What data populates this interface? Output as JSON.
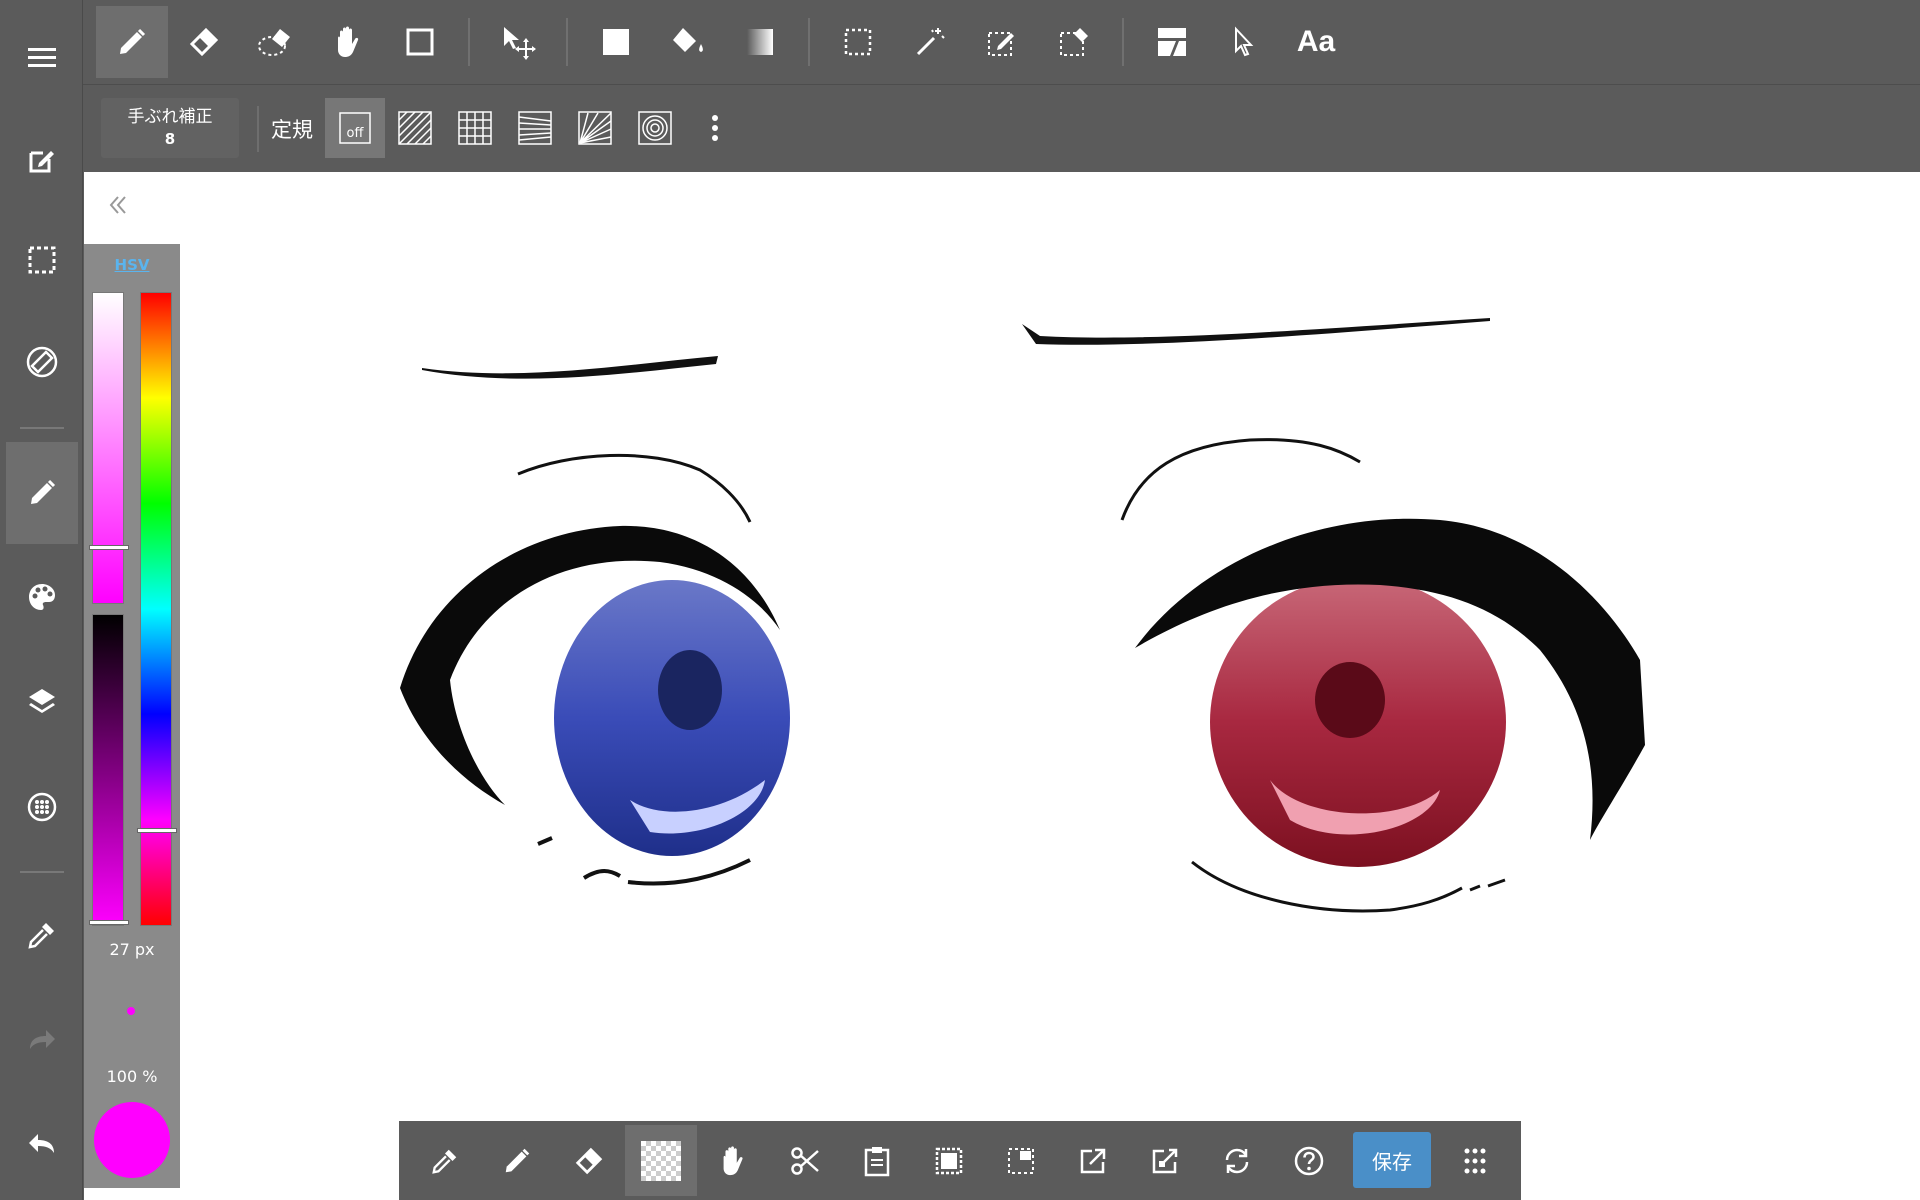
{
  "left_sidebar": {
    "items": [
      {
        "icon": "menu-icon"
      },
      {
        "icon": "edit-canvas-icon"
      },
      {
        "icon": "selection-icon"
      },
      {
        "icon": "rotate-canvas-icon"
      },
      {
        "icon": "pen-icon",
        "active": true
      },
      {
        "icon": "palette-icon"
      },
      {
        "icon": "layers-icon"
      },
      {
        "icon": "material-icon"
      },
      {
        "icon": "eyedropper-icon"
      },
      {
        "icon": "redo-icon"
      },
      {
        "icon": "undo-icon"
      }
    ]
  },
  "top_toolbar": {
    "tools": [
      "pen-icon",
      "eraser-icon",
      "lasso-eraser-icon",
      "hand-icon",
      "shape-icon",
      "move-icon",
      "fill-icon",
      "bucket-icon",
      "gradient-icon",
      "select-rect-icon",
      "magic-wand-icon",
      "select-pen-icon",
      "select-eraser-icon",
      "frame-divider-icon",
      "operation-icon",
      "text-icon"
    ],
    "text_tool_label": "Aa"
  },
  "sub_toolbar": {
    "stabilizer_label": "手ぶれ補正",
    "stabilizer_value": "8",
    "ruler_label": "定規",
    "ruler_off_label": "off",
    "rulers": [
      "ruler-off-icon",
      "parallel-ruler-icon",
      "grid-ruler-icon",
      "perspective-ruler-icon",
      "radial-ruler-icon",
      "concentric-ruler-icon"
    ],
    "more_icon": "more-vertical-icon"
  },
  "color_panel": {
    "mode_label": "HSV",
    "saturation": 0.82,
    "value": 1.0,
    "hue_position": 0.85,
    "brush_size_label": "27 px",
    "opacity_label": "100 %",
    "current_color": "#ff00ff"
  },
  "bottom_toolbar": {
    "tools": [
      "eyedropper-icon",
      "pen-icon",
      "eraser-icon",
      "transparent-color-icon",
      "hand-icon",
      "cut-icon",
      "paste-icon",
      "select-all-icon",
      "deselect-icon",
      "export-icon",
      "export-alt-icon",
      "rotate-icon",
      "help-icon"
    ],
    "save_label": "保存",
    "grid_icon": "apps-grid-icon"
  },
  "colors": {
    "toolbar_bg": "#5b5b5b",
    "active_bg": "#6e6e6e",
    "save_blue": "#4a8fc8",
    "hsv_link": "#5ab4ee"
  }
}
